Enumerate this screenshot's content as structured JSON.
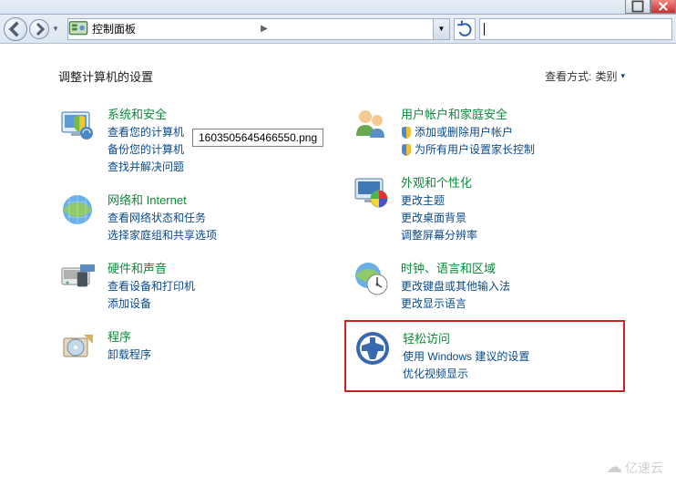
{
  "breadcrumb": {
    "root": "控制面板",
    "sep": "▶"
  },
  "page_title": "调整计算机的设置",
  "view_by": {
    "label": "查看方式:",
    "value": "类别",
    "caret": "▾"
  },
  "tooltip": "1603505645466550.png",
  "left": [
    {
      "title": "系统和安全",
      "links": [
        "查看您的计算机",
        "备份您的计算机",
        "查找并解决问题"
      ]
    },
    {
      "title": "网络和 Internet",
      "links": [
        "查看网络状态和任务",
        "选择家庭组和共享选项"
      ]
    },
    {
      "title": "硬件和声音",
      "links": [
        "查看设备和打印机",
        "添加设备"
      ]
    },
    {
      "title": "程序",
      "links": [
        "卸载程序"
      ]
    }
  ],
  "right": [
    {
      "title": "用户帐户和家庭安全",
      "shielded": [
        "添加或删除用户帐户",
        "为所有用户设置家长控制"
      ]
    },
    {
      "title": "外观和个性化",
      "links": [
        "更改主题",
        "更改桌面背景",
        "调整屏幕分辨率"
      ]
    },
    {
      "title": "时钟、语言和区域",
      "links": [
        "更改键盘或其他输入法",
        "更改显示语言"
      ]
    },
    {
      "title": "轻松访问",
      "links": [
        "使用 Windows 建议的设置",
        "优化视频显示"
      ]
    }
  ],
  "watermark": "亿速云"
}
